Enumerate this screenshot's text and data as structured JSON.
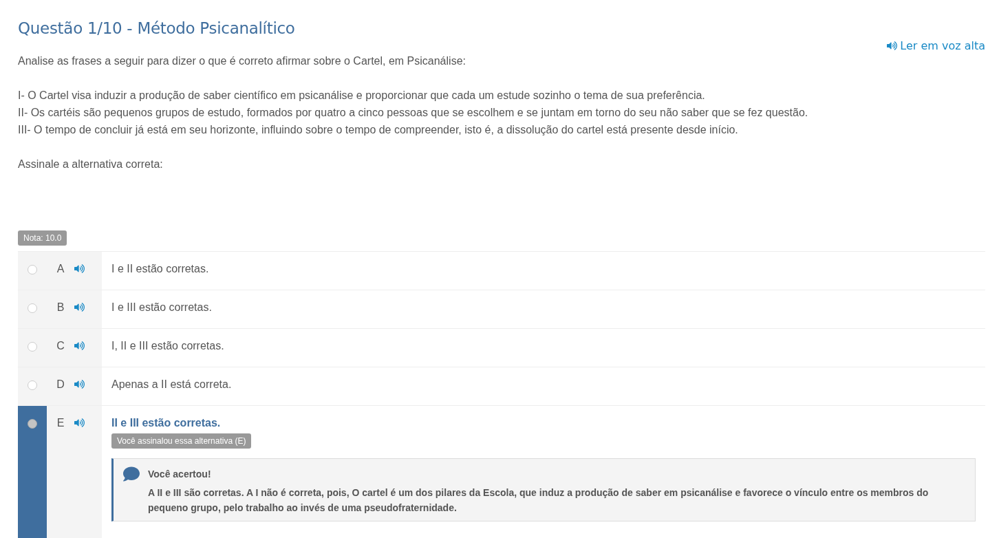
{
  "title": "Questão 1/10 - Método Psicanalítico",
  "read_aloud": "Ler em voz alta",
  "intro": "Analise as frases a seguir para dizer o que é correto afirmar sobre o Cartel, em Psicanálise:",
  "statements": [
    "I- O Cartel visa induzir a produção de saber científico em psicanálise e proporcionar que cada um estude sozinho o tema de sua preferência.",
    "II- Os cartéis são pequenos grupos de estudo, formados por quatro a cinco pessoas que se escolhem e se juntam em torno do seu não saber que se fez questão.",
    "III- O tempo de concluir já está em seu horizonte, influindo sobre o tempo de compreender, isto é, a dissolução do cartel está presente desde início."
  ],
  "prompt": "Assinale a alternativa correta:",
  "grade": "Nota: 10.0",
  "options": [
    {
      "letter": "A",
      "text": "I e II estão corretas.",
      "selected": false
    },
    {
      "letter": "B",
      "text": "I e III estão corretas.",
      "selected": false
    },
    {
      "letter": "C",
      "text": "I, II e III estão corretas.",
      "selected": false
    },
    {
      "letter": "D",
      "text": "Apenas a II está correta.",
      "selected": false
    },
    {
      "letter": "E",
      "text": "II e III estão corretas.",
      "selected": true,
      "badge": "Você assinalou essa alternativa (E)",
      "feedback": {
        "title": "Você acertou!",
        "text": "A II e III são corretas. A I não é correta, pois, O cartel é um dos pilares da Escola, que induz a produção de saber em psicanálise e favorece o vínculo entre os membros do pequeno grupo, pelo trabalho ao invés de uma pseudofraternidade."
      }
    }
  ]
}
